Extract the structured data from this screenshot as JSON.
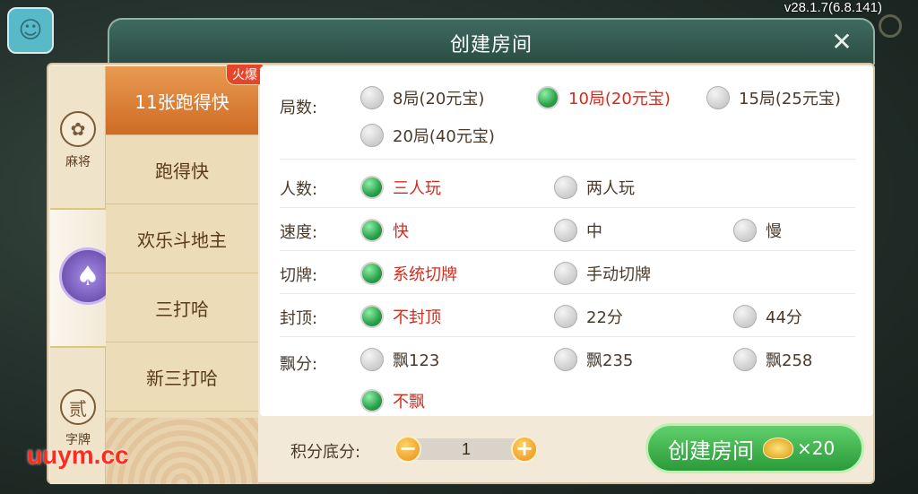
{
  "version": "v28.1.7(6.8.141)",
  "dialog": {
    "title": "创建房间"
  },
  "rail": {
    "cat_mahjong": "麻将",
    "cat_zipai": "字牌"
  },
  "games": [
    {
      "label": "11张跑得快",
      "hot": "火爆",
      "active": true
    },
    {
      "label": "跑得快"
    },
    {
      "label": "欢乐斗地主"
    },
    {
      "label": "三打哈"
    },
    {
      "label": "新三打哈"
    }
  ],
  "options": {
    "rounds": {
      "label": "局数:",
      "items": [
        "8局(20元宝)",
        "10局(20元宝)",
        "15局(25元宝)",
        "20局(40元宝)"
      ],
      "selected": "10局(20元宝)"
    },
    "players": {
      "label": "人数:",
      "items": [
        "三人玩",
        "两人玩"
      ],
      "selected": "三人玩"
    },
    "speed": {
      "label": "速度:",
      "items": [
        "快",
        "中",
        "慢"
      ],
      "selected": "快"
    },
    "cut": {
      "label": "切牌:",
      "items": [
        "系统切牌",
        "手动切牌"
      ],
      "selected": "系统切牌"
    },
    "cap": {
      "label": "封顶:",
      "items": [
        "不封顶",
        "22分",
        "44分"
      ],
      "selected": "不封顶"
    },
    "float": {
      "label": "飘分:",
      "items": [
        "飘123",
        "飘235",
        "飘258",
        "不飘"
      ],
      "selected": "不飘"
    }
  },
  "bottom": {
    "score_label": "积分底分:",
    "score_value": "1",
    "minus": "−",
    "plus": "+",
    "create_label": "创建房间",
    "create_cost": "×20"
  },
  "watermark": "uuym.cc"
}
